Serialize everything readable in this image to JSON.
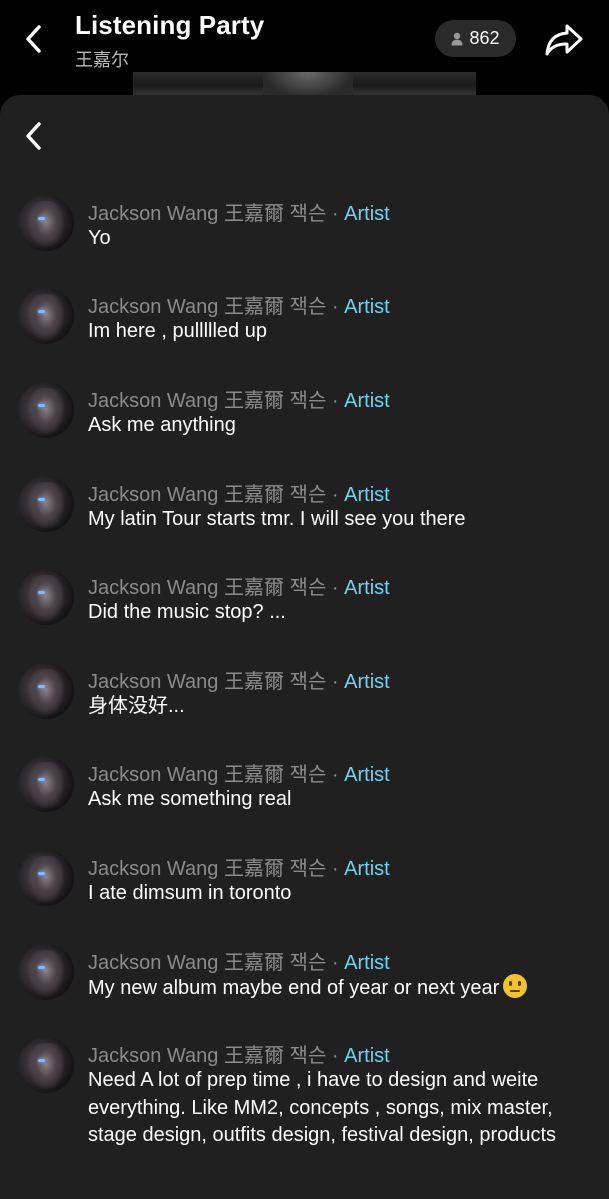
{
  "header": {
    "title": "Listening Party",
    "subtitle": "王嘉尔",
    "listener_count": "862"
  },
  "colors": {
    "background": "#000000",
    "sheet": "#202020",
    "artist_badge": "#6fd3ec",
    "username": "#8b8b8b"
  },
  "icons": {
    "back": "chevron-left-icon",
    "listeners": "person-icon",
    "share": "share-arrow-icon"
  },
  "messages": [
    {
      "author": "Jackson Wang 王嘉爾 잭슨",
      "separator": "·",
      "role": "Artist",
      "text": "Yo"
    },
    {
      "author": "Jackson Wang 王嘉爾 잭슨",
      "separator": "·",
      "role": "Artist",
      "text": "Im here , pullllled up"
    },
    {
      "author": "Jackson Wang 王嘉爾 잭슨",
      "separator": "·",
      "role": "Artist",
      "text": "Ask me anything"
    },
    {
      "author": "Jackson Wang 王嘉爾 잭슨",
      "separator": "·",
      "role": "Artist",
      "text": "My latin Tour starts tmr. I will see you there"
    },
    {
      "author": "Jackson Wang 王嘉爾 잭슨",
      "separator": "·",
      "role": "Artist",
      "text": "Did the music stop? ..."
    },
    {
      "author": "Jackson Wang 王嘉爾 잭슨",
      "separator": "·",
      "role": "Artist",
      "text": "身体没好..."
    },
    {
      "author": "Jackson Wang 王嘉爾 잭슨",
      "separator": "·",
      "role": "Artist",
      "text": "Ask me something real"
    },
    {
      "author": "Jackson Wang 王嘉爾 잭슨",
      "separator": "·",
      "role": "Artist",
      "text": "I ate dimsum in toronto"
    },
    {
      "author": "Jackson Wang 王嘉爾 잭슨",
      "separator": "·",
      "role": "Artist",
      "text": "My new album maybe end of year or next year",
      "emoji": "neutral-face-emoji"
    },
    {
      "author": "Jackson Wang 王嘉爾 잭슨",
      "separator": "·",
      "role": "Artist",
      "text": "Need A lot of prep time , i have to design and weite everything. Like MM2, concepts , songs, mix master, stage design, outfits design, festival design, products"
    }
  ]
}
